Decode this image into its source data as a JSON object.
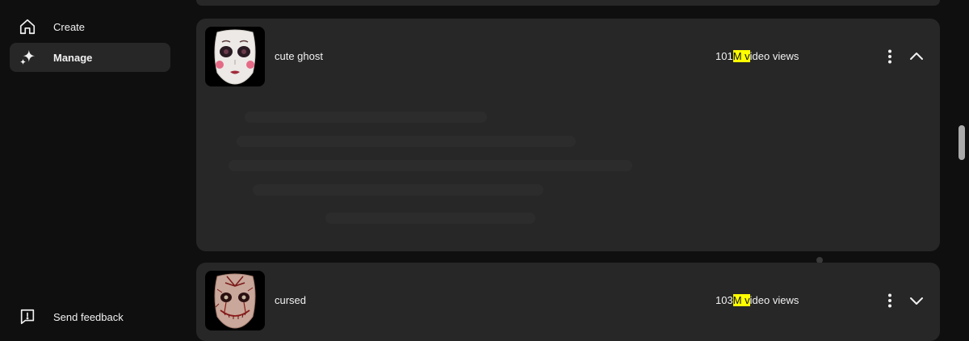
{
  "sidebar": {
    "items": [
      {
        "label": "Create",
        "icon": "home-icon"
      },
      {
        "label": "Manage",
        "icon": "sparkle-icon",
        "active": true
      }
    ],
    "feedback": {
      "label": "Send feedback",
      "icon": "feedback-icon"
    }
  },
  "effects": [
    {
      "title": "cute ghost",
      "views_prefix": "101",
      "views_highlight": "M v",
      "views_suffix": "ideo views",
      "expanded": true,
      "thumb_icon": "ghost-doll-face-icon"
    },
    {
      "title": "cursed",
      "views_prefix": "103",
      "views_highlight": "M v",
      "views_suffix": "ideo views",
      "expanded": false,
      "thumb_icon": "cursed-doll-face-icon"
    }
  ],
  "colors": {
    "background": "#0f0f0f",
    "card": "#272727",
    "highlight": "#ffff00",
    "text": "#f1f1f1"
  }
}
